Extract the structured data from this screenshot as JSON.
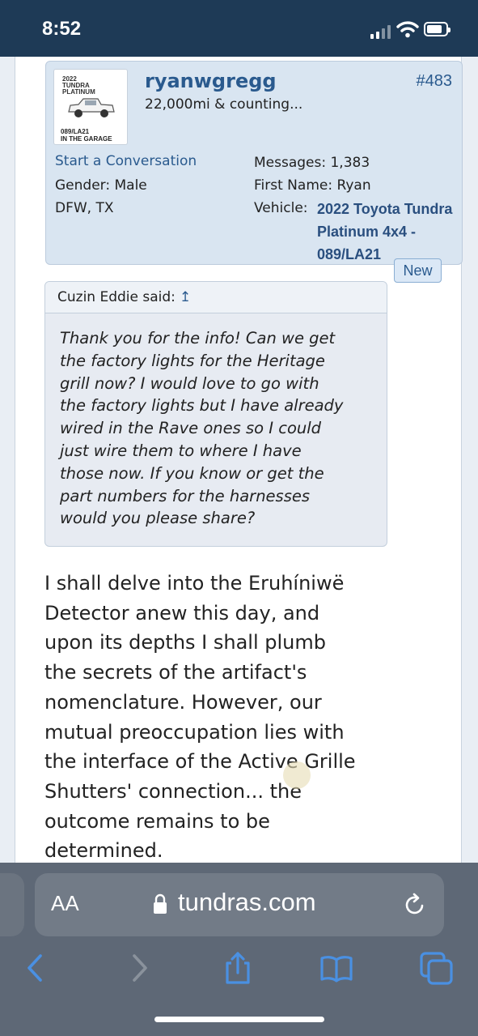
{
  "status_bar": {
    "time": "8:52"
  },
  "post": {
    "avatar": {
      "line1": "2022\nTUNDRA\nPLATINUM",
      "line2": "089/LA21\nIN THE GARAGE"
    },
    "username": "ryanwgregg",
    "user_title": "22,000mi & counting...",
    "post_number": "#483",
    "start_conversation": "Start a Conversation",
    "gender": "Gender: Male",
    "location": "DFW, TX",
    "messages": "Messages: 1,383",
    "first_name": "First Name: Ryan",
    "vehicle_label": "Vehicle:",
    "vehicle_value": "2022 Toyota Tundra Platinum 4x4 - 089/LA21",
    "new_badge": "New",
    "quote": {
      "author": "Cuzin Eddie said:",
      "arrow": "↥",
      "text": "Thank you for the info! Can we get\nthe factory lights for the Heritage\ngrill now? I would love to go with\nthe factory lights but I have already\nwired in the Rave ones so I could\njust wire them to where I have\nthose now. If you know or get the\npart numbers for the harnesses\nwould you please share?"
    },
    "body": "I shall delve into the Eruhíniwë\nDetector anew this day, and\nupon its depths I shall plumb\nthe secrets of the artifact's\nnomenclature. However, our\nmutual preoccupation lies with\nthe interface of the Active Grille\nShutters' connection... the\noutcome remains to be\ndetermined."
  },
  "browser": {
    "text_size_label": "AA",
    "url": "tundras.com",
    "icons": [
      "lock-icon",
      "reload-icon",
      "back-icon",
      "forward-icon",
      "share-icon",
      "bookmarks-icon",
      "tabs-icon"
    ]
  }
}
